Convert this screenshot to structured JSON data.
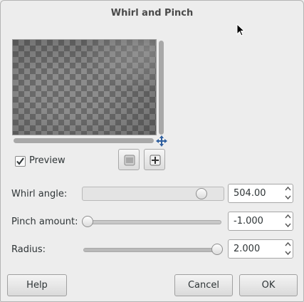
{
  "dialog": {
    "title": "Whirl and Pinch"
  },
  "preview": {
    "label": "Preview",
    "checked": true
  },
  "whirl_angle": {
    "label": "Whirl angle:",
    "value": "504.00",
    "level": 0.9
  },
  "pinch_amount": {
    "label": "Pinch amount:",
    "value": "-1.000",
    "level": 0.0
  },
  "radius": {
    "label": "Radius:",
    "value": "2.000",
    "level": 1.0
  },
  "buttons": {
    "help": "Help",
    "cancel": "Cancel",
    "ok": "OK"
  },
  "icons": {
    "navigate": "move-arrows-icon",
    "zoom_fit": "zoom-fit-icon",
    "zoom_in": "zoom-plus-icon",
    "spin_up": "chevron-up-icon",
    "spin_down": "chevron-down-icon"
  }
}
